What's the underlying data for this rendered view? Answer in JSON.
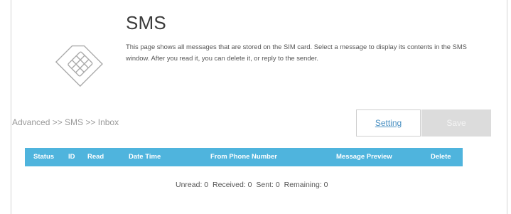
{
  "page": {
    "title": "SMS",
    "description": "This page shows all messages that are stored on the SIM card. Select a message to display its contents in the SMS window. After you read it, you can delete it, or reply to the sender."
  },
  "breadcrumb": "Advanced >> SMS >> Inbox",
  "buttons": {
    "setting_label": "Setting",
    "save_label": "Save"
  },
  "table": {
    "columns": [
      "Status",
      "ID",
      "Read",
      "Date Time",
      "From Phone Number",
      "Message Preview",
      "Delete"
    ],
    "rows": []
  },
  "summary": {
    "unread": "Unread: 0",
    "received": "Received: 0",
    "sent": "Sent: 0",
    "remaining": "Remaining: 0"
  },
  "icons": {
    "sim": "sim-card-icon"
  },
  "colors": {
    "header_bg": "#4fb4dd",
    "link": "#4a90c2",
    "save_bg": "#dcdcdc"
  }
}
